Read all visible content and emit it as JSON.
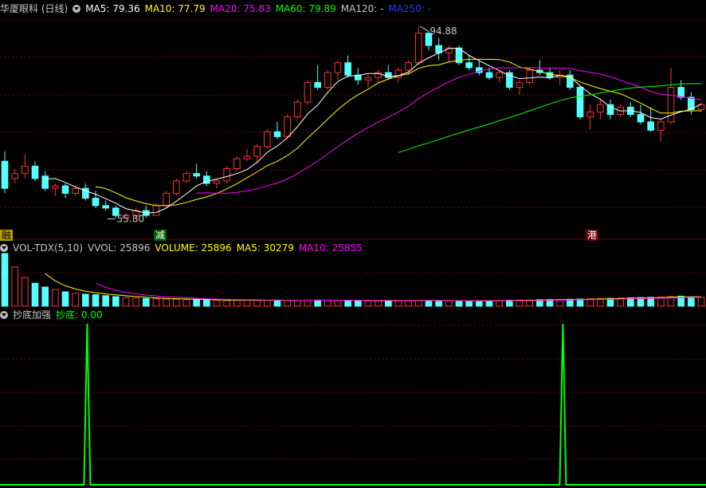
{
  "header": {
    "title": "华厦眼科 (日线)",
    "ma5": "MA5: 79.36",
    "ma10": "MA10: 77.79",
    "ma20": "MA20: 75.83",
    "ma60": "MA60: 79.89",
    "ma120": "MA120: -",
    "ma250": "MA250: -"
  },
  "vol_header": {
    "name": "VOL-TDX(5,10)",
    "vvol": "VVOL: 25896",
    "volume": "VOLUME: 25896",
    "ma5": "MA5: 30279",
    "ma10": "MA10: 25855"
  },
  "ind_header": {
    "name": "抄底加强",
    "value": "抄底: 0.00"
  },
  "markers": {
    "left": "融",
    "mid": "减",
    "right": "港"
  },
  "colors": {
    "up": "#ff3232",
    "down": "#54ffff",
    "ma5": "#ffffff",
    "ma10": "#ffff00",
    "ma20": "#ff00ff",
    "ma60": "#00ff00",
    "ma250": "#3232ff",
    "grid": "#7a0000",
    "indicator": "#00ff00"
  },
  "chart_data": [
    {
      "type": "candlestick",
      "ylim": [
        52,
        97
      ],
      "annotations": [
        {
          "label": "94.88",
          "index": 41,
          "value": 94.88
        },
        {
          "label": "55.80",
          "index": 10,
          "value": 55.8
        }
      ],
      "ohlc": [
        [
          67.5,
          69.5,
          61,
          62
        ],
        [
          64,
          66,
          63,
          65
        ],
        [
          65,
          69,
          64,
          66.5
        ],
        [
          66.5,
          67.5,
          63.5,
          64
        ],
        [
          64.5,
          65.5,
          61.5,
          62
        ],
        [
          62,
          63,
          60.5,
          62.5
        ],
        [
          62.5,
          63,
          60,
          61
        ],
        [
          61,
          62.5,
          60.5,
          62
        ],
        [
          62,
          63,
          59.5,
          60
        ],
        [
          60,
          61.5,
          58,
          58.5
        ],
        [
          58.5,
          59.5,
          57.5,
          58
        ],
        [
          58,
          58.5,
          56,
          56.5
        ],
        [
          56,
          57,
          55.8,
          56.5
        ],
        [
          56.5,
          58,
          55.9,
          57.5
        ],
        [
          57.5,
          58.5,
          56,
          56.5
        ],
        [
          56.5,
          59,
          56.5,
          58.5
        ],
        [
          58.5,
          61.5,
          58,
          61
        ],
        [
          61,
          64,
          60.5,
          63.5
        ],
        [
          63.5,
          65.5,
          63,
          65
        ],
        [
          65,
          67,
          64,
          64.5
        ],
        [
          64.5,
          65.5,
          62.5,
          63
        ],
        [
          63,
          64,
          62,
          63.5
        ],
        [
          63.5,
          66.5,
          63,
          66
        ],
        [
          66,
          68.5,
          65.5,
          68
        ],
        [
          68,
          70,
          67.5,
          68.5
        ],
        [
          68.5,
          71,
          67,
          70.5
        ],
        [
          70.5,
          74,
          70,
          73.5
        ],
        [
          73.5,
          75.5,
          72,
          72.5
        ],
        [
          72.5,
          77,
          72,
          76.5
        ],
        [
          76.5,
          80,
          76,
          79.5
        ],
        [
          79.5,
          84,
          79,
          83.5
        ],
        [
          83.5,
          87,
          82,
          82.5
        ],
        [
          82.5,
          86,
          82,
          85.5
        ],
        [
          85.5,
          88,
          84,
          87.5
        ],
        [
          87.5,
          89,
          84.5,
          85
        ],
        [
          85,
          86.5,
          83,
          84
        ],
        [
          84,
          85,
          82.5,
          84.5
        ],
        [
          84.5,
          86,
          83.5,
          85.5
        ],
        [
          85.5,
          87,
          84,
          84.5
        ],
        [
          84.5,
          86.5,
          83.5,
          86
        ],
        [
          86,
          88,
          85,
          87.5
        ],
        [
          87.5,
          94.88,
          87,
          93.5
        ],
        [
          93.5,
          94,
          90,
          91
        ],
        [
          91,
          92.5,
          88,
          89.5
        ],
        [
          89.5,
          91,
          87.5,
          90.5
        ],
        [
          90.5,
          91,
          87,
          87.5
        ],
        [
          87.5,
          89,
          86,
          86.5
        ],
        [
          86.5,
          88,
          85,
          85.5
        ],
        [
          85.5,
          86.5,
          84,
          84.5
        ],
        [
          84.5,
          86,
          83.5,
          85.5
        ],
        [
          85.5,
          86,
          82,
          82.5
        ],
        [
          82.5,
          84,
          81,
          83.5
        ],
        [
          83.5,
          86.5,
          83,
          86
        ],
        [
          86,
          88,
          85,
          85.5
        ],
        [
          85.5,
          86.5,
          84,
          84.5
        ],
        [
          84.5,
          86,
          83,
          85
        ],
        [
          85,
          86,
          82,
          82.5
        ],
        [
          82.5,
          83,
          76,
          76.5
        ],
        [
          76.5,
          79,
          74,
          77.5
        ],
        [
          77.5,
          80,
          76,
          79
        ],
        [
          79,
          80,
          76,
          77
        ],
        [
          77,
          79,
          76.5,
          78.5
        ],
        [
          78.5,
          79.5,
          76.5,
          77
        ],
        [
          77,
          79,
          75,
          75.5
        ],
        [
          75.5,
          78.5,
          73.5,
          73.8
        ],
        [
          73.8,
          76,
          71.5,
          75.5
        ],
        [
          75.5,
          86.5,
          75,
          82.5
        ],
        [
          82.5,
          84,
          80,
          80.5
        ],
        [
          80.5,
          81.5,
          77,
          78
        ],
        [
          78,
          79.5,
          77.5,
          79
        ]
      ]
    },
    {
      "type": "bar",
      "ylim": [
        0,
        110000
      ],
      "values": [
        110000,
        82000,
        60000,
        48000,
        40000,
        35000,
        30000,
        27000,
        25000,
        24000,
        22000,
        20000,
        18000,
        17000,
        16000,
        15500,
        15000,
        14500,
        14000,
        13500,
        13000,
        12500,
        12000,
        12500,
        13000,
        12800,
        12500,
        12000,
        12200,
        12500,
        13000,
        12800,
        12500,
        12000,
        11800,
        11500,
        11000,
        11200,
        11500,
        12000,
        12500,
        12000,
        11800,
        11500,
        11000,
        10800,
        10500,
        11000,
        11500,
        12000,
        12500,
        12800,
        13000,
        13500,
        13800,
        14000,
        14500,
        15000,
        15500,
        16000,
        16500,
        17000,
        17500,
        18000,
        18500,
        19000,
        20000,
        21000,
        19500,
        18500
      ]
    },
    {
      "type": "line",
      "ylim": [
        0,
        1
      ],
      "spikes": [
        12,
        80
      ]
    }
  ]
}
